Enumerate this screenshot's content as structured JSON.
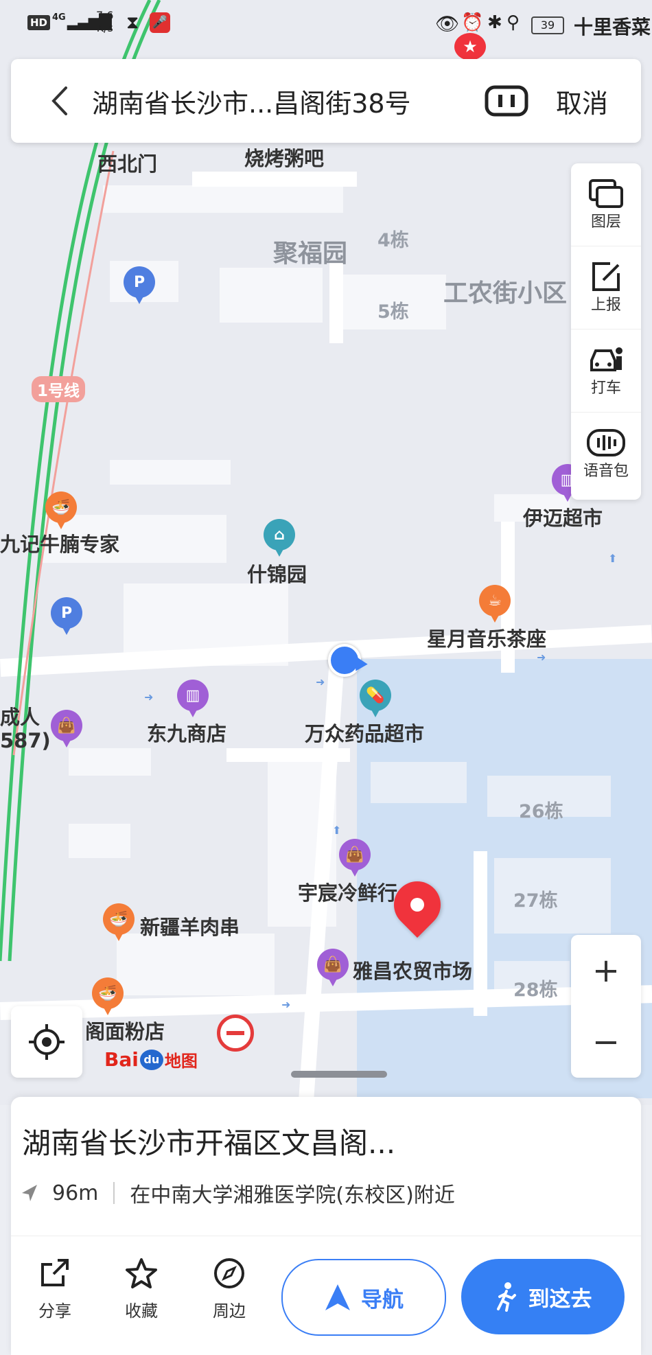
{
  "status_bar": {
    "network": "HD",
    "signal_type": "4G",
    "speed_value": "7.6",
    "speed_unit": "K/s",
    "battery": "39",
    "carrier_text": "十里香菜"
  },
  "search": {
    "back_icon": "chevron-left-icon",
    "query": "湖南省长沙市...昌阁街38号",
    "ar_icon": "ar-scan-icon",
    "cancel_label": "取消"
  },
  "right_panel": {
    "items": [
      {
        "label": "图层",
        "icon": "layers-icon"
      },
      {
        "label": "上报",
        "icon": "edit-report-icon"
      },
      {
        "label": "打车",
        "icon": "taxi-icon"
      },
      {
        "label": "语音包",
        "icon": "voice-pack-icon"
      }
    ]
  },
  "zoom": {
    "in_label": "+",
    "out_label": "−"
  },
  "map": {
    "logo_text_a": "Bai",
    "logo_text_b": "地图",
    "line_label": "1号线",
    "area_labels": {
      "jufuyuan": "聚福园",
      "gongnong": "工农街小区"
    },
    "buildings": {
      "b4": "4栋",
      "b5": "5栋",
      "b26": "26栋",
      "b27": "27栋",
      "b28": "28栋"
    },
    "pois": {
      "xibeimen": "西北门",
      "shaokao": "烧烤粥吧",
      "jiuji": "九记牛腩专家",
      "shijinyuan": "什锦园",
      "yimai": "伊迈超市",
      "xingyue": "星月音乐茶座",
      "dongjiu": "东九商店",
      "wanzhong": "万众药品超市",
      "chengren_a": "成人",
      "chengren_b": "587)",
      "yuchen": "宇宸冷鲜行",
      "xinjiang": "新疆羊肉串",
      "yachang": "雅昌农贸市场",
      "gemian": "阁面粉店"
    }
  },
  "sheet": {
    "title": "湖南省长沙市开福区文昌阁...",
    "distance": "96m",
    "nearby": "在中南大学湘雅医学院(东校区)附近",
    "actions": [
      {
        "label": "分享",
        "icon": "share-icon"
      },
      {
        "label": "收藏",
        "icon": "star-icon"
      },
      {
        "label": "周边",
        "icon": "compass-icon"
      }
    ],
    "nav_label": "导航",
    "go_label": "到这去"
  },
  "colors": {
    "accent": "#3580f4",
    "pin_red": "#f0333c",
    "poi_purple": "#a05fd6",
    "poi_orange": "#f47c38",
    "poi_teal": "#3aa3b8",
    "parking_blue": "#4f7ee0"
  }
}
